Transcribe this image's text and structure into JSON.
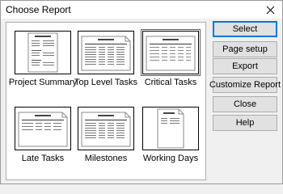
{
  "window": {
    "title": "Choose Report"
  },
  "reports": [
    {
      "label": "Project Summary"
    },
    {
      "label": "Top Level Tasks"
    },
    {
      "label": "Critical Tasks",
      "selected": true
    },
    {
      "label": "Late Tasks"
    },
    {
      "label": "Milestones"
    },
    {
      "label": "Working Days"
    }
  ],
  "buttons": {
    "select": "Select",
    "page_setup": "Page setup",
    "export": "Export",
    "customize": "Customize Report",
    "close": "Close",
    "help": "Help"
  },
  "colors": {
    "accent": "#0078d7",
    "button_bg": "#e1e1e1"
  }
}
